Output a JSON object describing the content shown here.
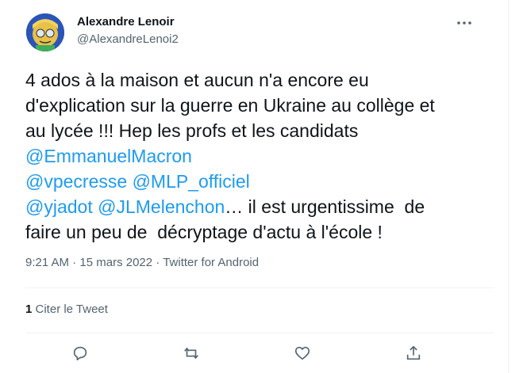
{
  "tweet": {
    "author_name": "Alexandre Lenoir",
    "author_handle": "@AlexandreLenoi2",
    "text_lines": [
      "4 ados à la maison et aucun n'a encore eu",
      "d'explication sur la guerre en Ukraine au collège et",
      "au lycée !!! Hep les profs et les candidats"
    ],
    "mentions": [
      "@EmmanuelMacron",
      "@vpecresse",
      "@MLP_officiel",
      "@yjadot",
      "@JLMelenchon"
    ],
    "text_tail_1": "… il est urgentissime  de",
    "text_tail_2": "faire un peu de  décryptage d'actu à l'école !",
    "time": "9:21 AM",
    "date": "15 mars 2022",
    "source": "Twitter for Android",
    "separator": "·",
    "quote_count": "1",
    "quote_label": "Citer le Tweet"
  },
  "colors": {
    "text": "#0f1419",
    "secondary": "#536471",
    "link": "#1d9bf0",
    "divider": "#eff3f4"
  },
  "icons": {
    "more": "more-dots-icon",
    "reply": "reply-icon",
    "retweet": "retweet-icon",
    "like": "heart-icon",
    "share": "share-icon"
  }
}
